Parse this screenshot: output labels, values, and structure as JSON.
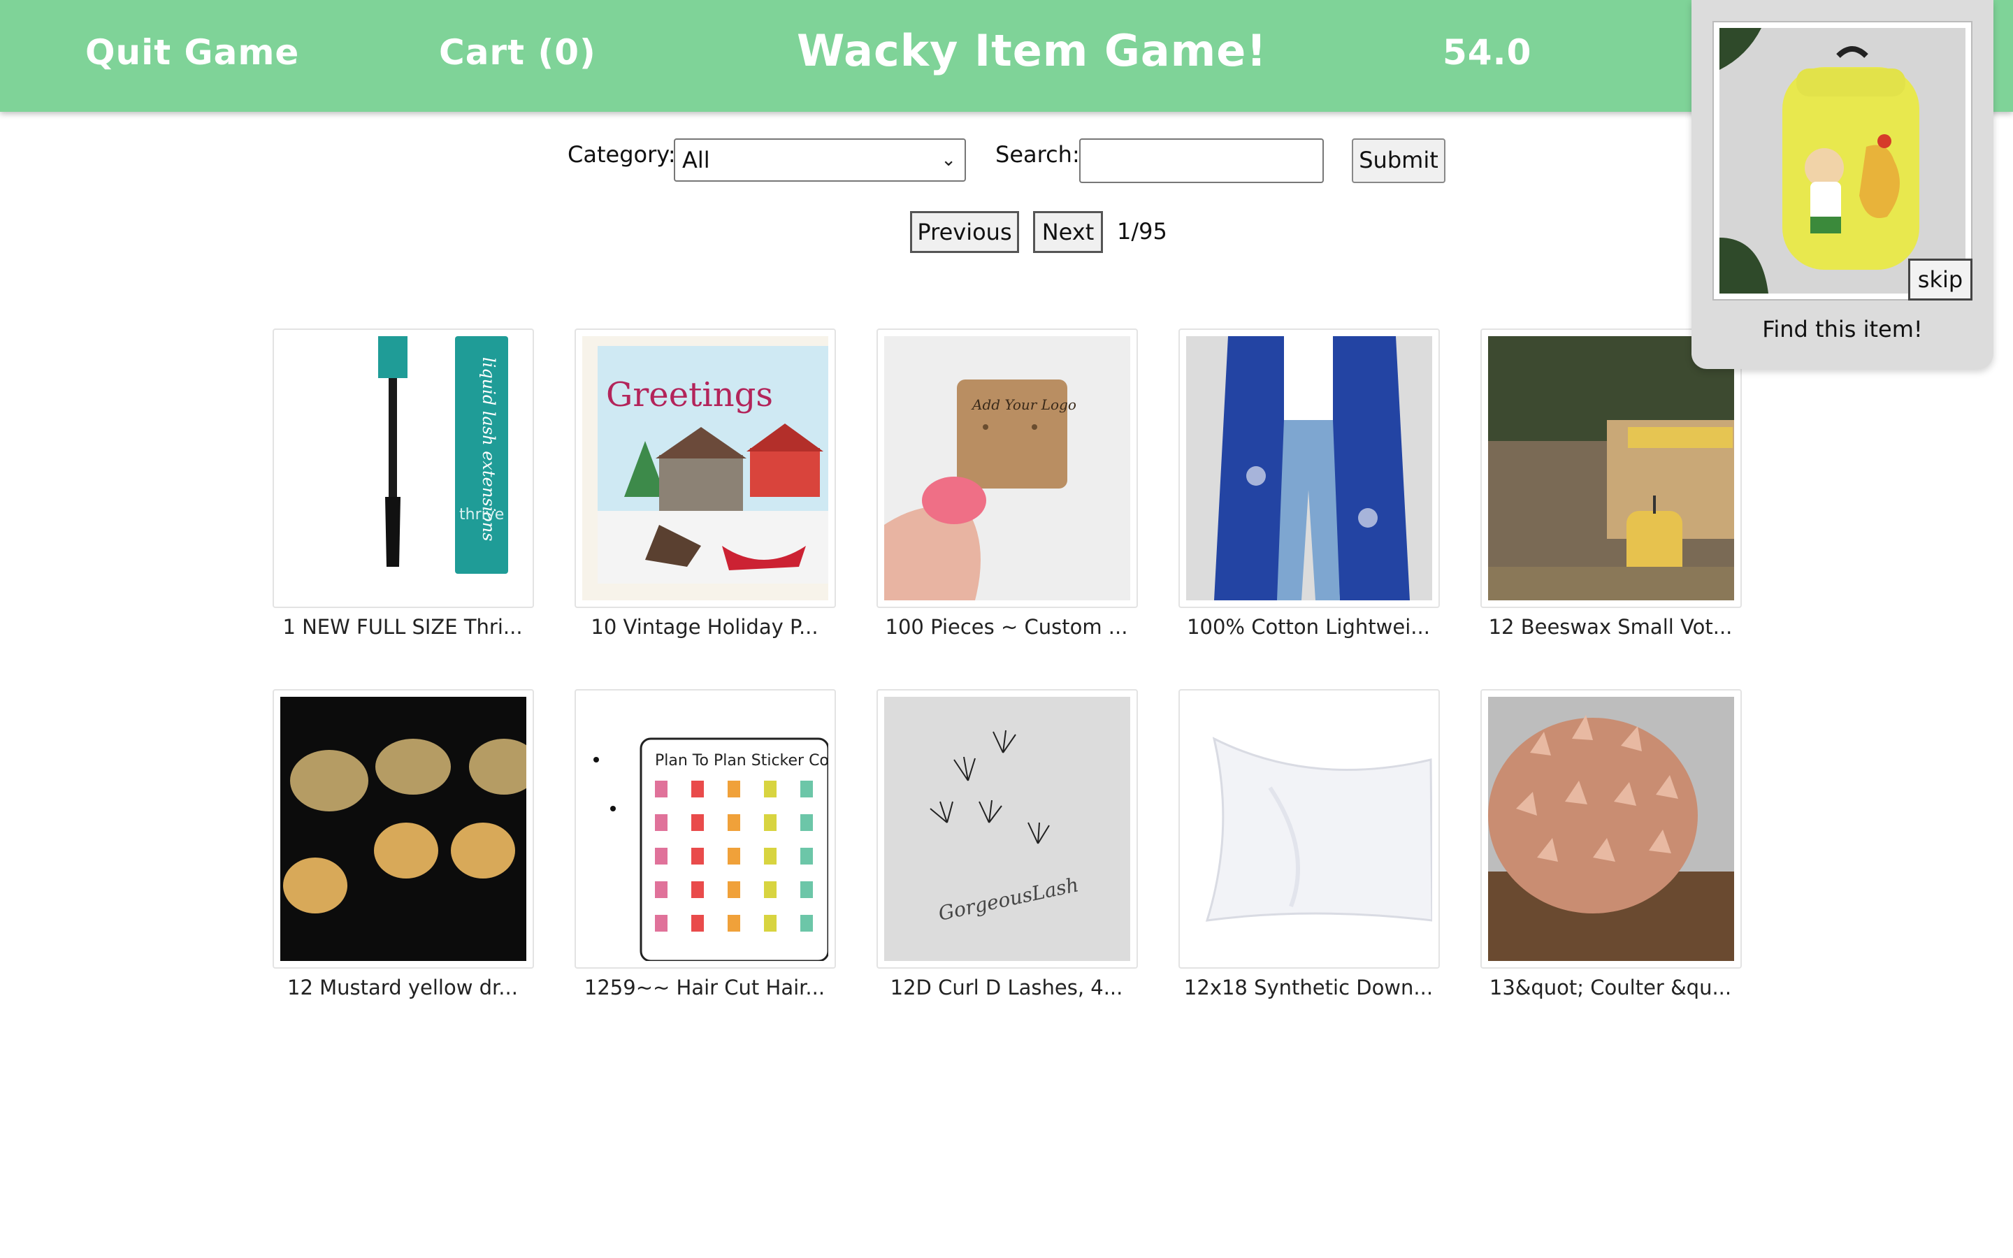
{
  "header": {
    "quit": "Quit Game",
    "cart": "Cart (0)",
    "title": "Wacky Item Game!",
    "score": "54.0"
  },
  "filters": {
    "category_label": "Category:",
    "category_value": "All",
    "search_label": "Search:",
    "search_value": "",
    "submit": "Submit"
  },
  "pagination": {
    "previous": "Previous",
    "next": "Next",
    "page": "1/95"
  },
  "items": [
    {
      "caption": "1 NEW FULL SIZE Thri...",
      "icon": "mascara-icon",
      "image_text": [
        "liquid lash extensions",
        "thrive"
      ]
    },
    {
      "caption": "10 Vintage Holiday P...",
      "icon": "holiday-stamp-icon",
      "image_text": [
        "Greetings"
      ]
    },
    {
      "caption": "100 Pieces ~ Custom ...",
      "icon": "earring-card-icon",
      "image_text": [
        "Add Your Logo"
      ]
    },
    {
      "caption": "100% Cotton Lightwei...",
      "icon": "kimono-icon"
    },
    {
      "caption": "12 Beeswax Small Vot...",
      "icon": "candle-icon"
    },
    {
      "caption": "12 Mustard yellow dr...",
      "icon": "wax-discs-icon"
    },
    {
      "caption": "1259~~ Hair Cut Hair...",
      "icon": "sticker-sheet-icon",
      "image_text": [
        "Plan To Plan Sticker Co."
      ]
    },
    {
      "caption": "12D Curl D Lashes, 4...",
      "icon": "lash-fans-icon",
      "image_text": [
        "GorgeousLash"
      ]
    },
    {
      "caption": "12x18 Synthetic Down...",
      "icon": "pillow-icon"
    },
    {
      "caption": "13&quot; Coulter &qu...",
      "icon": "pinecone-icon"
    }
  ],
  "target": {
    "skip": "skip",
    "prompt": "Find this item!",
    "icon": "yellow-backpack-icon"
  },
  "colors": {
    "header_bg": "#7fd398",
    "panel_bg": "#dcdcdc"
  }
}
